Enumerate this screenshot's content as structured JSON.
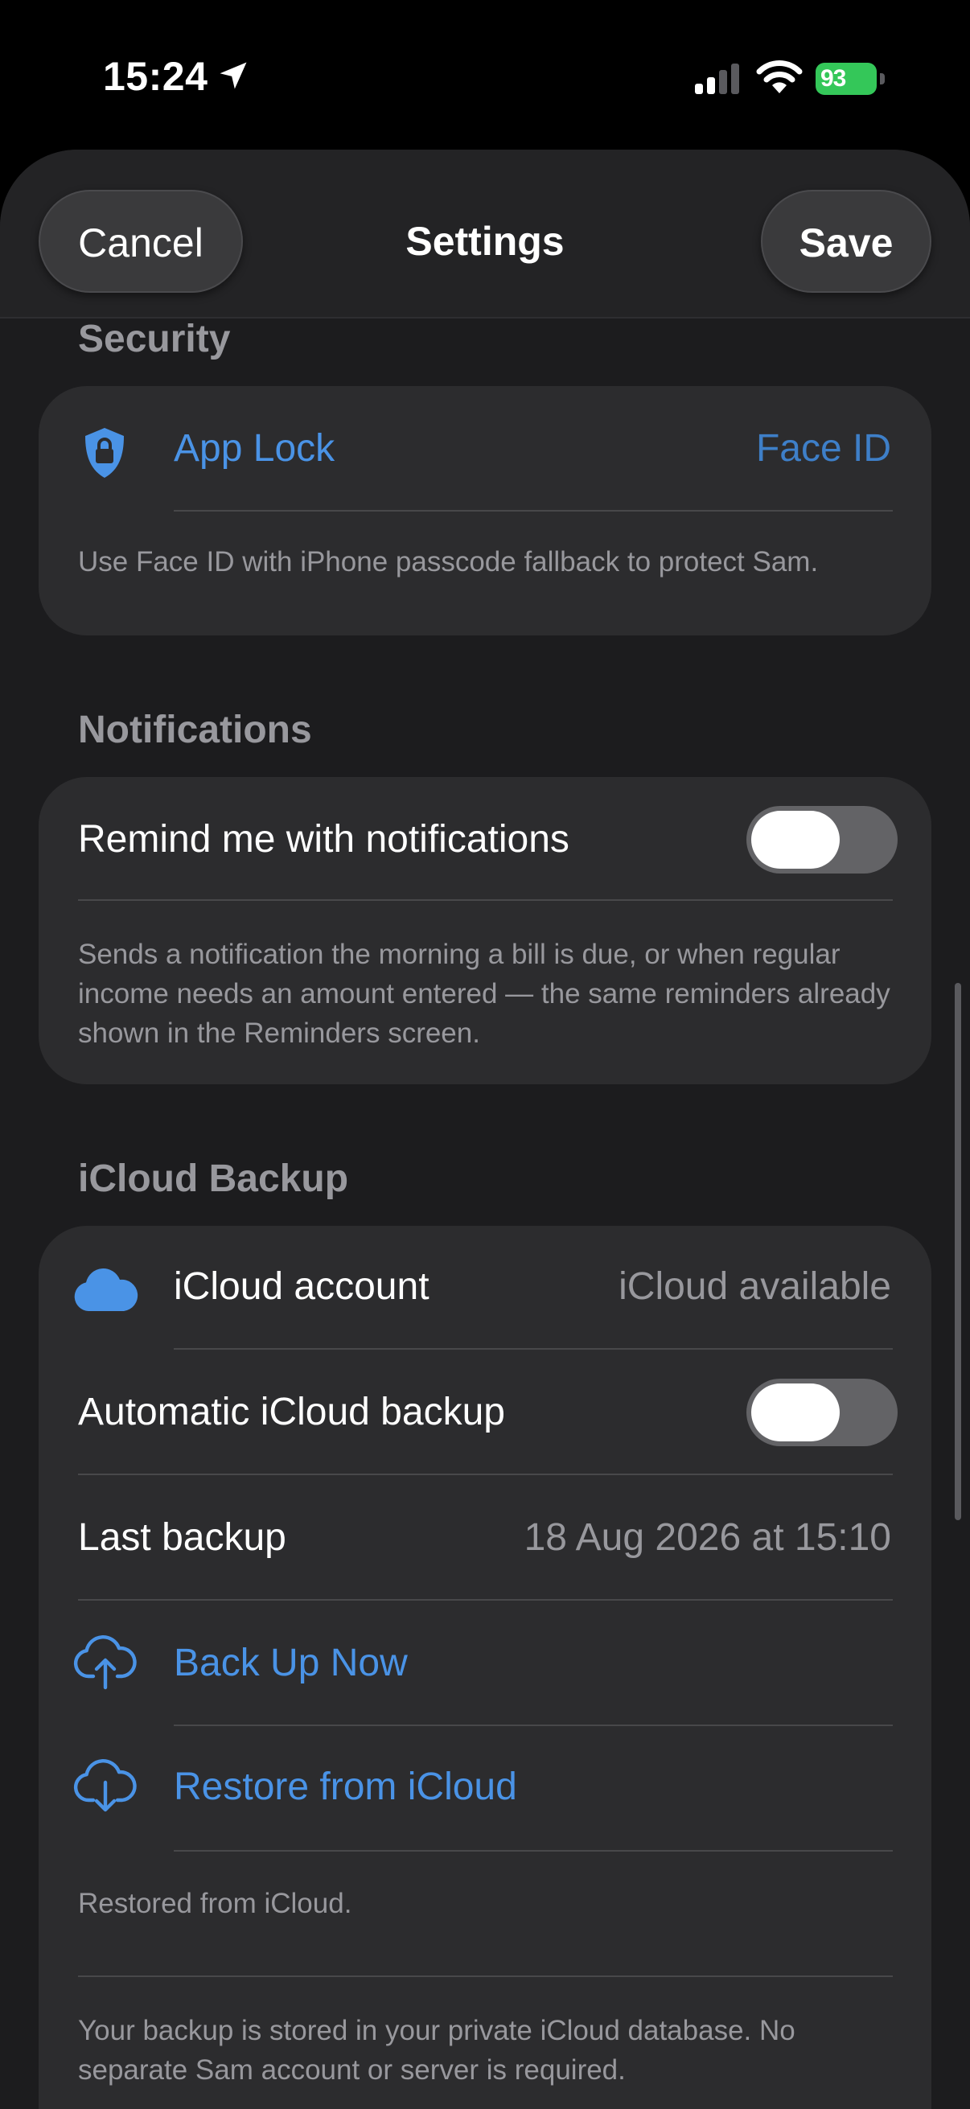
{
  "status_bar": {
    "time": "15:24",
    "battery": "93"
  },
  "nav": {
    "cancel_label": "Cancel",
    "title": "Settings",
    "save_label": "Save"
  },
  "security": {
    "header": "Security",
    "app_lock_label": "App Lock",
    "app_lock_value": "Face ID",
    "footnote": "Use Face ID with iPhone passcode fallback to protect Sam."
  },
  "notifications": {
    "header": "Notifications",
    "remind_label": "Remind me with notifications",
    "remind_enabled": false,
    "footnote": "Sends a notification the morning a bill is due, or when regular income needs an amount entered — the same reminders already shown in the Reminders screen."
  },
  "icloud": {
    "header": "iCloud Backup",
    "account_label": "iCloud account",
    "account_value": "iCloud available",
    "auto_backup_label": "Automatic iCloud backup",
    "auto_backup_enabled": false,
    "last_backup_label": "Last backup",
    "last_backup_value": "18 Aug 2026 at 15:10",
    "back_up_now_label": "Back Up Now",
    "restore_label": "Restore from iCloud",
    "restored_note": "Restored from iCloud.",
    "footnote": "Your backup is stored in your private iCloud database. No separate Sam account or server is required."
  },
  "colors": {
    "accent": "#4a93e6",
    "background": "#1c1c1e",
    "card": "#2c2c2e",
    "secondary_text": "#98989d",
    "battery": "#34c759"
  },
  "icons": {
    "app_lock": "lock-shield-icon",
    "icloud_account": "cloud-icon",
    "back_up_now": "cloud-upload-icon",
    "restore": "cloud-download-icon"
  }
}
